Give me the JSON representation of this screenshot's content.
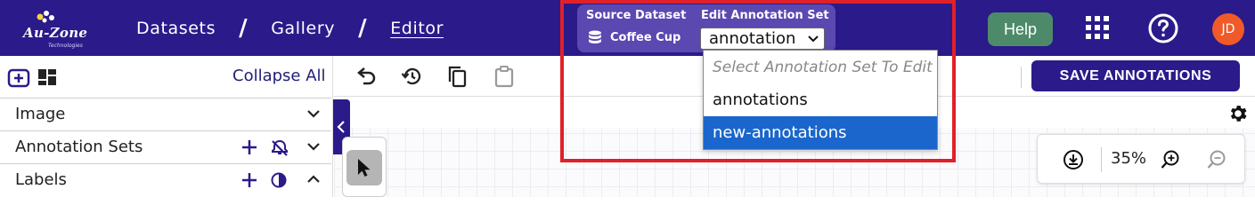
{
  "header": {
    "logo": {
      "brand": "Au-Zone",
      "tagline": "Technologies"
    },
    "breadcrumb": [
      {
        "label": "Datasets"
      },
      {
        "label": "Gallery"
      },
      {
        "label": "Editor"
      }
    ],
    "breadcrumb_separator": "/",
    "source_dataset_label": "Source Dataset",
    "source_dataset_value": "Coffee Cup",
    "edit_annotation_label": "Edit Annotation Set",
    "annotation_select_value": "annotation",
    "help_label": "Help",
    "avatar_initials": "JD"
  },
  "dropdown": {
    "placeholder": "Select Annotation Set To Edit",
    "options": [
      "annotations",
      "new-annotations"
    ],
    "highlighted": "new-annotations"
  },
  "left_panel": {
    "collapse_all": "Collapse All",
    "sections": [
      {
        "title": "Image"
      },
      {
        "title": "Annotation Sets"
      },
      {
        "title": "Labels"
      }
    ]
  },
  "toolbar": {
    "save_label": "SAVE ANNOTATIONS"
  },
  "zoom": {
    "level": "35%"
  },
  "colors": {
    "header_bg": "#2b1a8a",
    "panel_bg": "#5b48b0",
    "help_bg": "#4d8a6a",
    "avatar_bg": "#f05a28",
    "highlight": "#e0202a",
    "selected_option": "#1a66cc"
  }
}
